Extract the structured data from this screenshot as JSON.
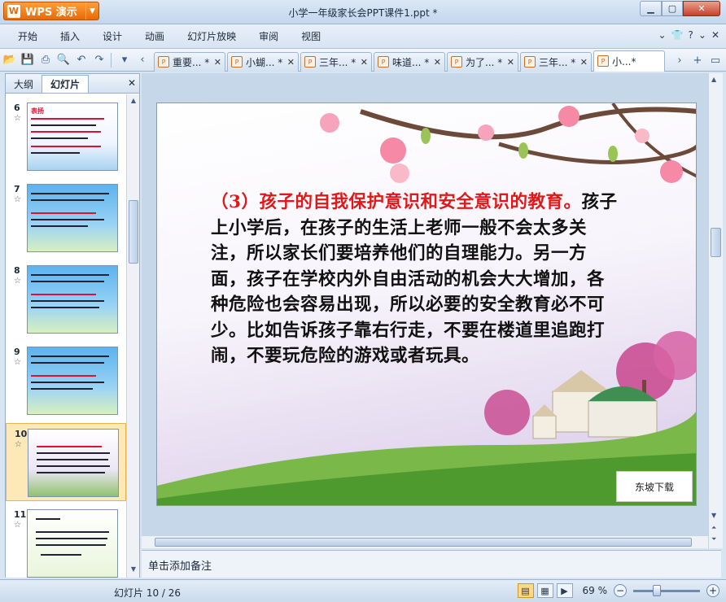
{
  "app": {
    "name": "WPS 演示",
    "logo_glyph": "W",
    "window_title": "小学一年级家长会PPT课件1.ppt *"
  },
  "menu": {
    "items": [
      "开始",
      "插入",
      "设计",
      "动画",
      "幻灯片放映",
      "审阅",
      "视图"
    ]
  },
  "tabs": [
    {
      "label": "重要... *",
      "active": false
    },
    {
      "label": "小蝴... *",
      "active": false
    },
    {
      "label": "三年... *",
      "active": false
    },
    {
      "label": "味道... *",
      "active": false
    },
    {
      "label": "为了... *",
      "active": false
    },
    {
      "label": "三年... *",
      "active": false
    },
    {
      "label": "小...*",
      "active": true
    }
  ],
  "left_panel": {
    "tabs": [
      "大纲",
      "幻灯片"
    ],
    "active_tab": "幻灯片",
    "slides": [
      {
        "number": "6",
        "selected": false
      },
      {
        "number": "7",
        "selected": false
      },
      {
        "number": "8",
        "selected": false
      },
      {
        "number": "9",
        "selected": false
      },
      {
        "number": "10",
        "selected": true
      },
      {
        "number": "11",
        "selected": false
      }
    ],
    "thumb_title_6": "表扬"
  },
  "slide": {
    "text_red": "（3）孩子的自我保护意识和安全意识的教育。",
    "text_black": "孩子上小学后，在孩子的生活上老师一般不会太多关注，所以家长们要培养他们的自理能力。另一方面，孩子在学校内外自由活动的机会大大增加，各种危险也会容易出现，所以必要的安全教育必不可少。比如告诉孩子靠右行走，不要在楼道里追跑打闹，不要玩危险的游戏或者玩具。",
    "watermark": "东坡下载"
  },
  "notes": {
    "placeholder": "单击添加备注"
  },
  "status": {
    "slide_indicator": "幻灯片 10 / 26",
    "zoom": "69 %"
  },
  "colors": {
    "accent_orange": "#e86a06",
    "highlight_red": "#e01818"
  }
}
